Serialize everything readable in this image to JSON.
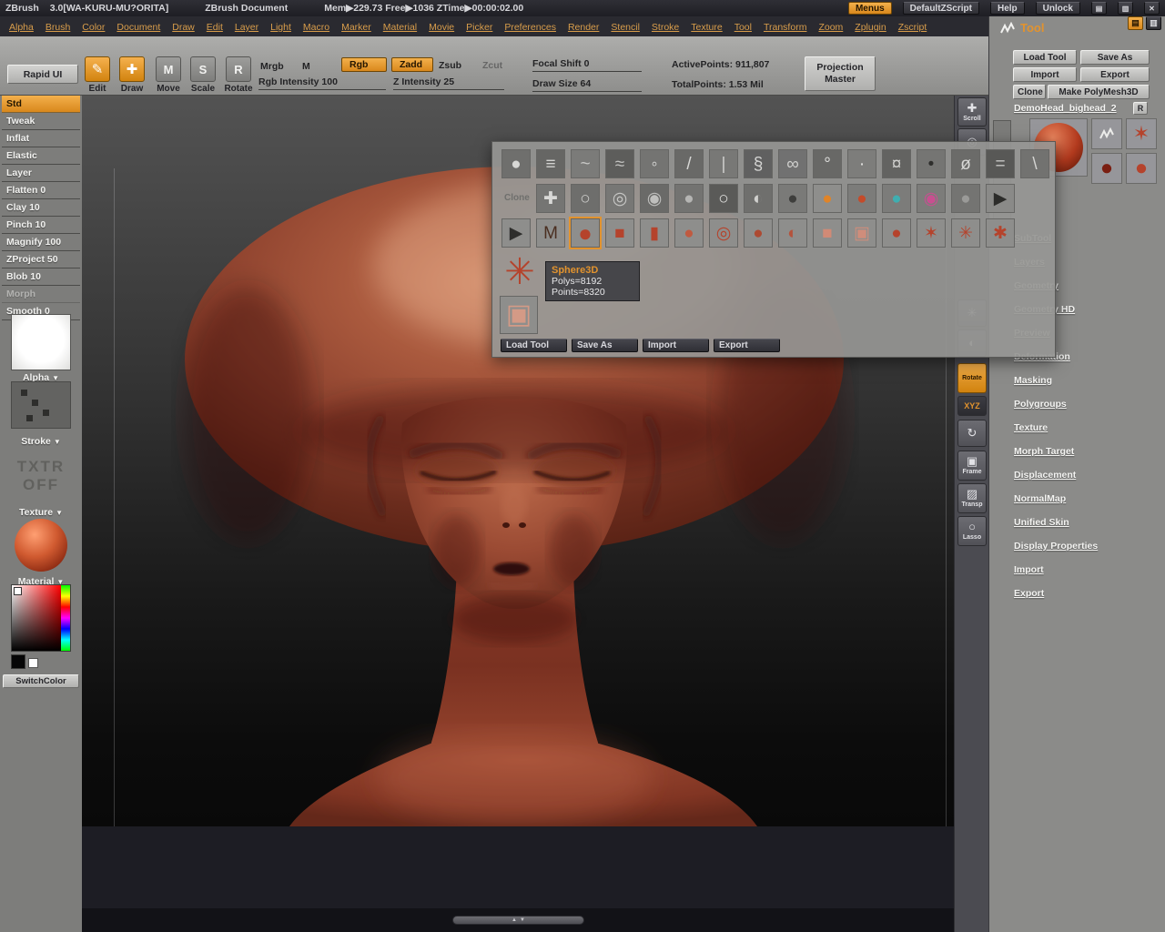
{
  "colors": {
    "accent": "#e2932e",
    "sculpt_red": "#9a4a33"
  },
  "titlebar": {
    "app_name": "ZBrush",
    "version": "3.0[WA-KURU-MU?ORITA]",
    "document_label": "ZBrush Document",
    "stats": "Mem▶229.73  Free▶1036  ZTime▶00:00:02.00",
    "menus_button": "Menus",
    "default_zscript_button": "DefaultZScript",
    "help_button": "Help",
    "unlock_button": "Unlock",
    "win_buttons": [
      "▤",
      "▥",
      "✕"
    ]
  },
  "menubar": {
    "items": [
      "Alpha",
      "Brush",
      "Color",
      "Document",
      "Draw",
      "Edit",
      "Layer",
      "Light",
      "Macro",
      "Marker",
      "Material",
      "Movie",
      "Picker",
      "Preferences",
      "Render",
      "Stencil",
      "Stroke",
      "Texture",
      "Tool",
      "Transform",
      "Zoom",
      "Zplugin",
      "Zscript"
    ]
  },
  "toolbar": {
    "rapid_ui": "Rapid UI",
    "edit": "Edit",
    "edit_icon": "✎",
    "draw": "Draw",
    "draw_icon": "✚",
    "move": "Move",
    "move_icon": "M",
    "scale": "Scale",
    "scale_icon": "S",
    "rotate": "Rotate",
    "rotate_icon": "R",
    "mrgb": "Mrgb",
    "m": "M",
    "rgb": "Rgb",
    "zadd": "Zadd",
    "zsub": "Zsub",
    "zcut": "Zcut",
    "rgb_intensity": "Rgb Intensity 100",
    "z_intensity": "Z Intensity 25",
    "focal_shift": "Focal Shift 0",
    "draw_size": "Draw Size 64",
    "active_points": "ActivePoints: 911,807",
    "total_points": "TotalPoints: 1.53 Mil",
    "projection_master": "Projection Master"
  },
  "sidebar": {
    "brushes": [
      {
        "label": "Std",
        "selected": true
      },
      {
        "label": "Tweak"
      },
      {
        "label": "Inflat"
      },
      {
        "label": "Elastic"
      },
      {
        "label": "Layer"
      },
      {
        "label": "Flatten 0"
      },
      {
        "label": "Clay 10"
      },
      {
        "label": "Pinch 10"
      },
      {
        "label": "Magnify 100"
      },
      {
        "label": "ZProject 50"
      },
      {
        "label": "Blob 10"
      },
      {
        "label": "Morph",
        "dim": true
      },
      {
        "label": "Smooth 0"
      }
    ],
    "alpha_label": "Alpha",
    "stroke_label": "Stroke",
    "texture_label": "Texture",
    "material_label": "Material",
    "txtr_off": [
      "TXTR",
      "OFF"
    ],
    "switch_color": "SwitchColor",
    "dropdown_glyph": "▼"
  },
  "popup": {
    "clone_label": "Clone",
    "row1": [
      {
        "name": "dot-brush-icon",
        "glyph": "●",
        "bg": "#6f6f6d",
        "fg": "#d8d8d6"
      },
      {
        "name": "layer-stack-brush-icon",
        "glyph": "≡",
        "bg": "#666664",
        "fg": "#d2d2d0"
      },
      {
        "name": "smear-brush-icon",
        "glyph": "~",
        "bg": "#7b7b79",
        "fg": "#c8c8c6"
      },
      {
        "name": "smudge-brush-icon",
        "glyph": "≈",
        "bg": "#5d5d5b",
        "fg": "#c2c2c0"
      },
      {
        "name": "soft-round-brush-icon",
        "glyph": "◦",
        "bg": "#747472",
        "fg": "#e2e2e0"
      },
      {
        "name": "knife-stroke-icon",
        "glyph": "/",
        "bg": "#696967",
        "fg": "#d8d8d6"
      },
      {
        "name": "fiber-brush-icon",
        "glyph": "|",
        "bg": "#787876",
        "fg": "#cccccb"
      },
      {
        "name": "snake-stroke-icon",
        "glyph": "§",
        "bg": "#606060",
        "fg": "#d5d5d3"
      },
      {
        "name": "wave-stroke-icon",
        "glyph": "∞",
        "bg": "#717171",
        "fg": "#d0d0ce"
      },
      {
        "name": "hook-stroke-icon",
        "glyph": "°",
        "bg": "#686866",
        "fg": "#dcdcda"
      },
      {
        "name": "fine-line-brush-icon",
        "glyph": "·",
        "bg": "#7d7d7b",
        "fg": "#e6e6e4"
      },
      {
        "name": "texture-dab-brush-icon",
        "glyph": "¤",
        "bg": "#636361",
        "fg": "#cfcfcd"
      },
      {
        "name": "splatter-brush-icon",
        "glyph": "•",
        "bg": "#757573",
        "fg": "#2e2e2c"
      },
      {
        "name": "airbrush-icon",
        "glyph": "ø",
        "bg": "#6b6b69",
        "fg": "#d8d8d6"
      },
      {
        "name": "marker-dab-icon",
        "glyph": "=",
        "bg": "#585856",
        "fg": "#c6c6c4"
      },
      {
        "name": "curve-stroke-icon",
        "glyph": "\\",
        "bg": "#727270",
        "fg": "#d4d4d2"
      }
    ],
    "row2": [
      {
        "name": "clone-target-icon",
        "glyph": "✚",
        "bg": "#757573",
        "fg": "#d8d8d6"
      },
      {
        "name": "soft-circle-alpha-icon",
        "glyph": "○",
        "bg": "#6e6e6c",
        "fg": "#cfcfcd"
      },
      {
        "name": "ring-circle-alpha-icon",
        "glyph": "◎",
        "bg": "#777775",
        "fg": "#c8c8c6"
      },
      {
        "name": "dot-circle-alpha-icon",
        "glyph": "◉",
        "bg": "#6a6a68",
        "fg": "#bfbfbd"
      },
      {
        "name": "hard-circle-alpha-icon",
        "glyph": "●",
        "bg": "#737371",
        "fg": "#b5b5b3"
      },
      {
        "name": "halo-circle-alpha-icon",
        "glyph": "○",
        "bg": "#5a5a58",
        "fg": "#e2e2e0"
      },
      {
        "name": "gradient-circle-alpha-icon",
        "glyph": "◐",
        "bg": "#6f6f6d",
        "fg": "#d0d0ce"
      },
      {
        "name": "dark-circle-alpha-icon",
        "glyph": "●",
        "bg": "#7a7a78",
        "fg": "#3e3e3c"
      },
      {
        "name": "orange-material-ball-icon",
        "glyph": "●",
        "bg": "#83838  1",
        "fg": "#e08428"
      },
      {
        "name": "red-material-ball-icon",
        "glyph": "●",
        "bg": "#7c7c7a",
        "fg": "#c44b2a"
      },
      {
        "name": "teal-material-ball-icon",
        "glyph": "●",
        "bg": "#7c7c7a",
        "fg": "#3faeb0"
      },
      {
        "name": "rainbow-material-ball-icon",
        "glyph": "◉",
        "bg": "#7c7c7a",
        "fg": "#c84f90"
      },
      {
        "name": "gray-material-ball-icon",
        "glyph": "●",
        "bg": "#747472",
        "fg": "#9a9a98"
      },
      {
        "name": "scroll-right-icon",
        "glyph": "▶",
        "bg": "#8a8a88",
        "fg": "#2c2c2a"
      }
    ],
    "row3": [
      {
        "name": "insert-arrow-icon",
        "glyph": "▶",
        "fg": "#2e2e2c"
      },
      {
        "name": "mrgbz-grabber-icon",
        "glyph": "M",
        "fg": "#4a2e20"
      },
      {
        "name": "sphere3d-tool-icon",
        "glyph": "●",
        "fg": "#b5432c",
        "selected": true
      },
      {
        "name": "cube3d-tool-icon",
        "glyph": "■",
        "fg": "#b5432c"
      },
      {
        "name": "cylinder3d-tool-icon",
        "glyph": "▮",
        "fg": "#b5432c"
      },
      {
        "name": "cone3d-tool-icon",
        "glyph": "●",
        "fg": "#c05a40"
      },
      {
        "name": "ring3d-tool-icon",
        "glyph": "◎",
        "fg": "#b5432c"
      },
      {
        "name": "polysphere-tool-icon",
        "glyph": "●",
        "fg": "#ad4a32"
      },
      {
        "name": "blob-tool-icon",
        "glyph": "◐",
        "fg": "#b5533c"
      },
      {
        "name": "plane3d-tool-icon",
        "glyph": "■",
        "fg": "#d18a76"
      },
      {
        "name": "plane3d-rounded-tool-icon",
        "glyph": "▣",
        "fg": "#cf8d7b"
      },
      {
        "name": "sphere-small-tool-icon",
        "glyph": "●",
        "fg": "#b5432c"
      },
      {
        "name": "star3d-tool-icon",
        "glyph": "✶",
        "fg": "#b5432c"
      },
      {
        "name": "spiral3d-tool-icon",
        "glyph": "✳",
        "fg": "#b5432c"
      },
      {
        "name": "helix3d-tool-icon",
        "glyph": "✱",
        "fg": "#b5432c"
      }
    ],
    "current_big": {
      "name": "gear3d-tool-icon",
      "glyph": "✳"
    },
    "secondary": {
      "name": "polymesh3d-tool-icon",
      "glyph": "▣"
    },
    "tooltip": {
      "title": "Sphere3D",
      "polys": "Polys=8192",
      "points": "Points=8320"
    },
    "buttons": [
      "Load Tool",
      "Save As",
      "Import",
      "Export"
    ]
  },
  "right_strip": {
    "scroll": {
      "glyph": "✚",
      "label": "Scroll"
    },
    "magnify": {
      "glyph": "◎"
    },
    "flower": {
      "glyph": "✳"
    },
    "halfsphere": {
      "glyph": "◐"
    },
    "rotate": {
      "label": "Rotate"
    },
    "xyz": {
      "glyph": "◉",
      "label": "XYZ"
    },
    "orbit": {
      "glyph": "↻"
    },
    "frame": {
      "glyph": "▣",
      "label": "Frame"
    },
    "transp": {
      "glyph": "▨",
      "label": "Transp"
    },
    "lasso": {
      "glyph": "○",
      "label": "Lasso"
    }
  },
  "right_panel": {
    "title": "Tool",
    "corner_buttons": [
      "▤",
      "▥"
    ],
    "load_tool": "Load Tool",
    "save_as": "Save As",
    "import": "Import",
    "export": "Export",
    "clone": "Clone",
    "make_polymesh": "Make PolyMesh3D",
    "current_tool": "DemoHead_bighead_2",
    "restore_btn": "R",
    "icons": {
      "star": "✶",
      "sphere": "●",
      "sphere_dark": "●"
    },
    "sections": [
      {
        "label": "SubTool"
      },
      {
        "label": "Layers"
      },
      {
        "label": "Geometry"
      },
      {
        "label": "Geometry HD"
      },
      {
        "label": "Preview"
      },
      {
        "label": "Deformation"
      },
      {
        "label": "Masking"
      },
      {
        "label": "Polygroups"
      },
      {
        "label": "Texture"
      },
      {
        "label": "Morph Target"
      },
      {
        "label": "Displacement"
      },
      {
        "label": "NormalMap"
      },
      {
        "label": "Unified Skin"
      },
      {
        "label": "Display Properties"
      },
      {
        "label": "Import"
      },
      {
        "label": "Export"
      }
    ]
  },
  "scrollbar": {
    "up": "▲",
    "down": "▼"
  }
}
